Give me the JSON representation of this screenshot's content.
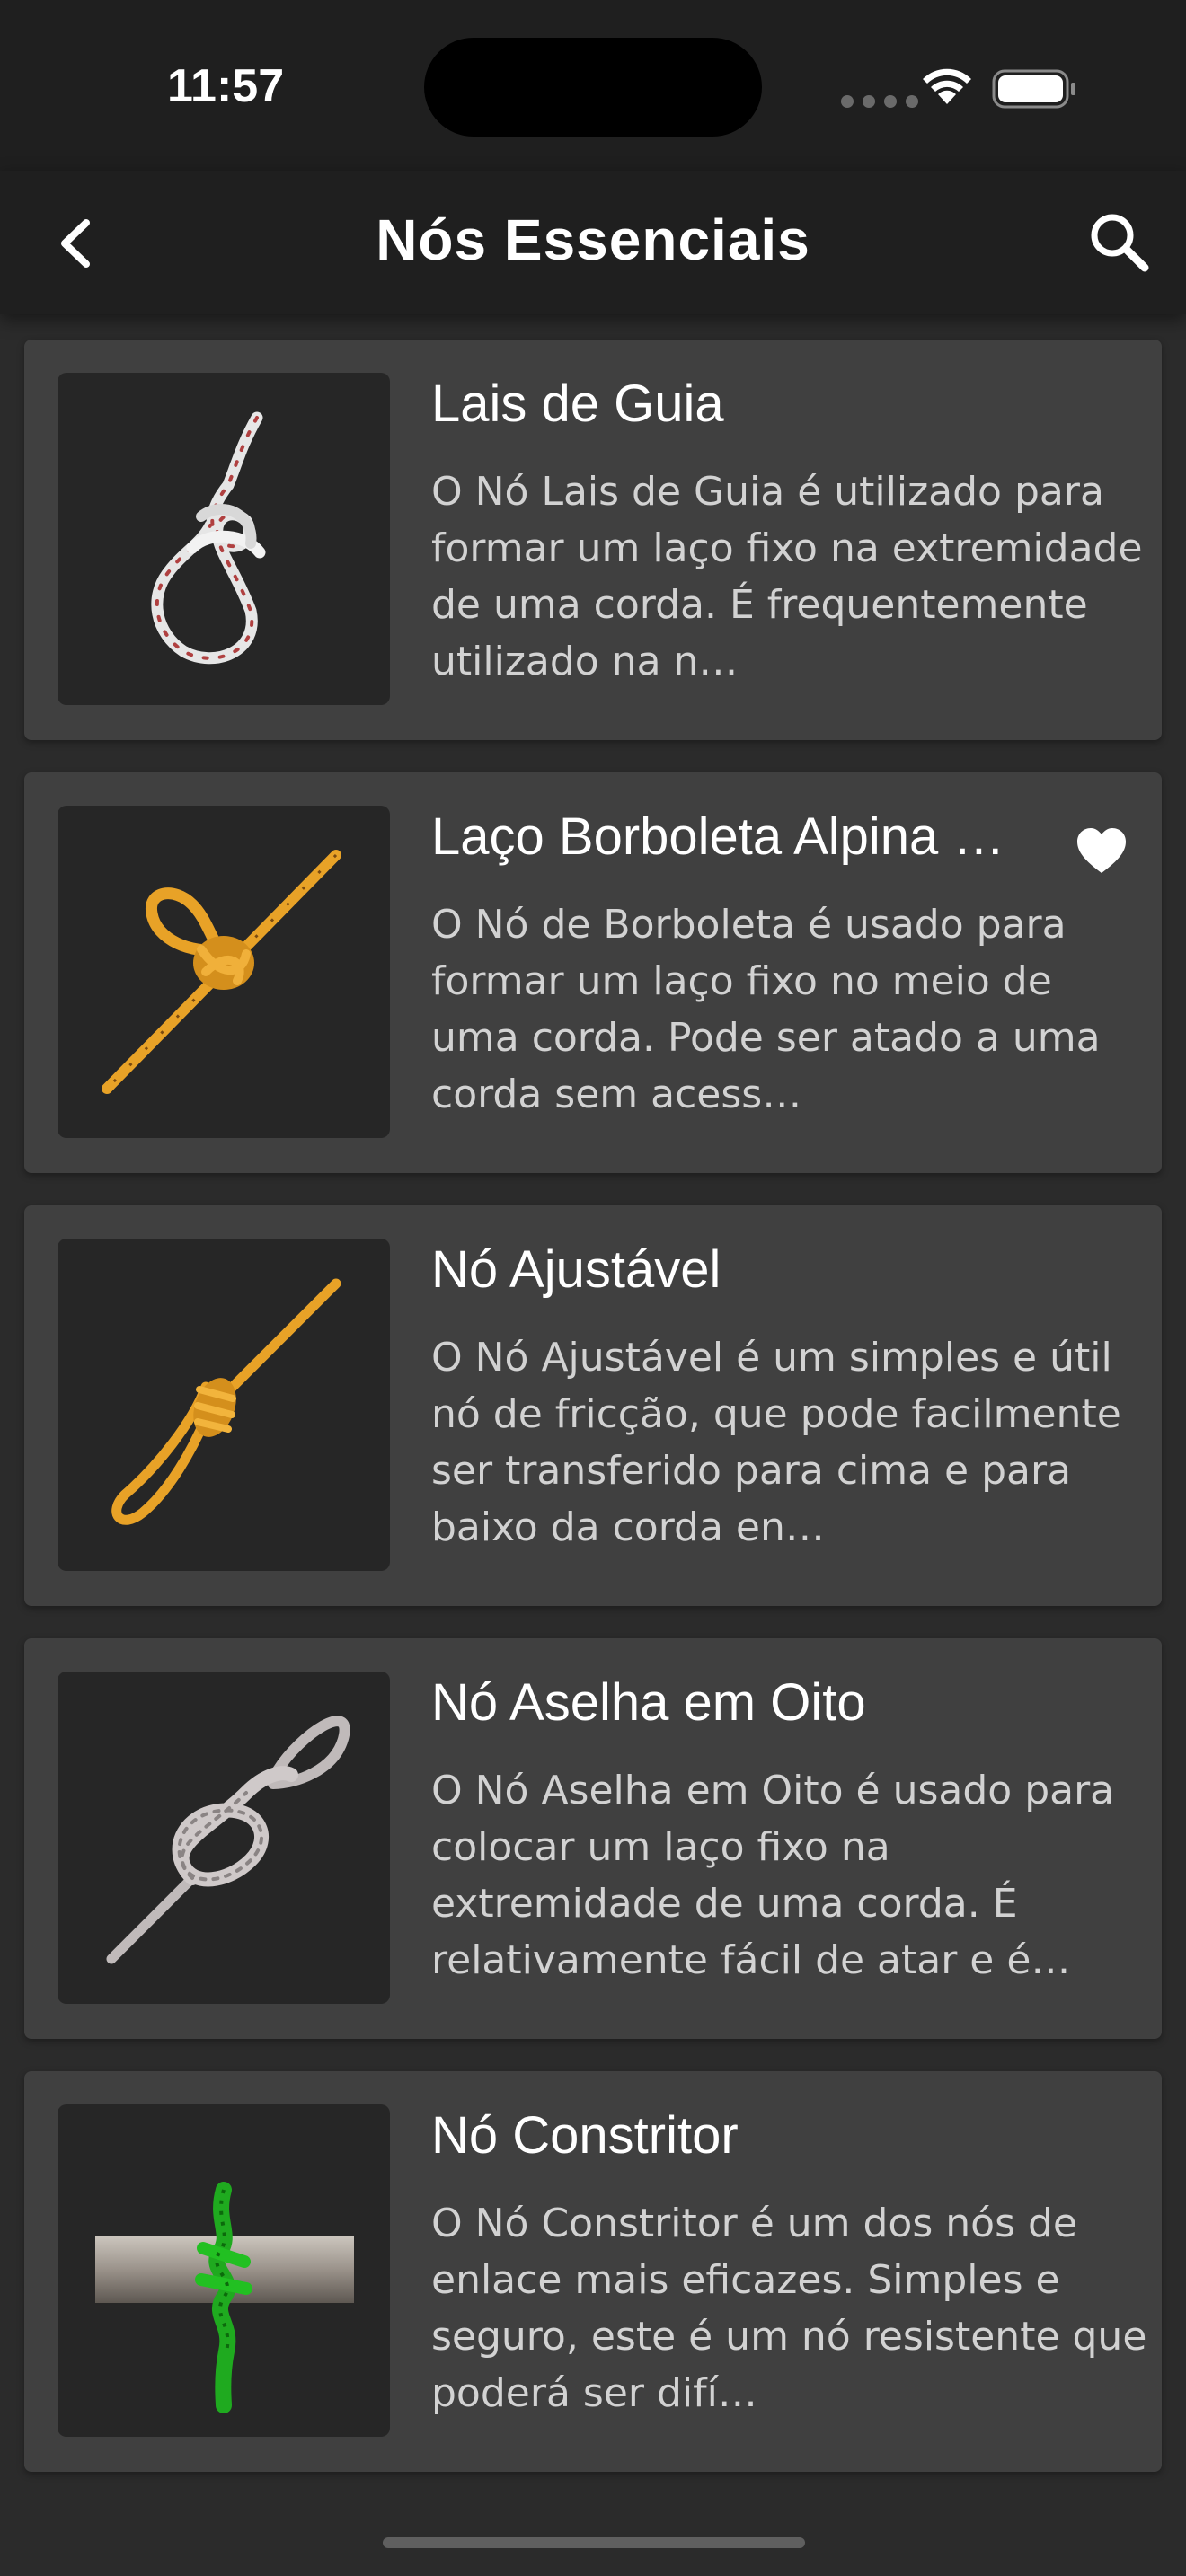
{
  "status_bar": {
    "time": "11:57"
  },
  "nav": {
    "title": "Nós Essenciais",
    "back_icon": "chevron-left-icon",
    "search_icon": "search-icon"
  },
  "knots": [
    {
      "title": "Lais de Guia",
      "description": "O Nó Lais de Guia é utilizado para formar um laço fixo na extremidade de uma corda. É frequentemente utilizado na n…",
      "favorite": false,
      "rope_color": "#d9d9d9"
    },
    {
      "title": "Laço Borboleta Alpina …",
      "description": "O Nó de Borboleta é usado para formar um laço fixo no meio de uma corda. Pode ser atado a uma corda sem acess…",
      "favorite": true,
      "rope_color": "#e8a227"
    },
    {
      "title": "Nó Ajustável",
      "description": "O Nó Ajustável é um simples e útil nó de fricção, que pode facilmente ser transferido para cima e para baixo da corda en…",
      "favorite": false,
      "rope_color": "#e8a227"
    },
    {
      "title": "Nó Aselha em Oito",
      "description": "O Nó Aselha em Oito é usado para colocar um laço fixo na extremidade de uma corda. É relativamente fácil de atar e é…",
      "favorite": false,
      "rope_color": "#b8b2b2"
    },
    {
      "title": "Nó Constritor",
      "description": "O Nó Constritor é um dos nós de enlace mais eficazes. Simples e seguro, este é um nó resistente que poderá ser difí…",
      "favorite": false,
      "rope_color": "#1faa1f"
    }
  ]
}
